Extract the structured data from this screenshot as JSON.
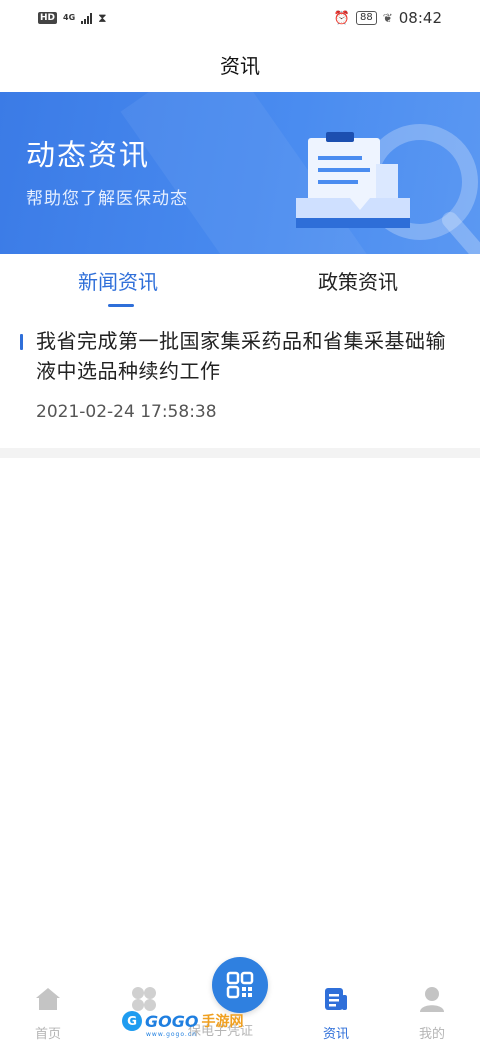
{
  "status_bar": {
    "hd": "HD",
    "network": "4G",
    "battery": "88",
    "time": "08:42"
  },
  "header": {
    "title": "资讯"
  },
  "banner": {
    "title": "动态资讯",
    "subtitle": "帮助您了解医保动态"
  },
  "tabs": [
    {
      "label": "新闻资讯",
      "active": true
    },
    {
      "label": "政策资讯",
      "active": false
    }
  ],
  "news": [
    {
      "title": "我省完成第一批国家集采药品和省集采基础输液中选品种续约工作",
      "date": "2021-02-24 17:58:38"
    }
  ],
  "tabbar": {
    "items": [
      {
        "label": "首页",
        "icon": "home-icon"
      },
      {
        "label": "",
        "icon": "services-grid-icon"
      },
      {
        "label": "保电子凭证",
        "icon": "qr-code-icon"
      },
      {
        "label": "资讯",
        "icon": "news-icon",
        "active": true
      },
      {
        "label": "我的",
        "icon": "user-icon"
      }
    ]
  },
  "watermark": {
    "brand": "GOGO",
    "suffix": "手游网",
    "url": "www.gogo.cn"
  },
  "colors": {
    "accent": "#2f6fd9",
    "banner": "#4a8cf0",
    "inactive": "#b5b5b5"
  }
}
